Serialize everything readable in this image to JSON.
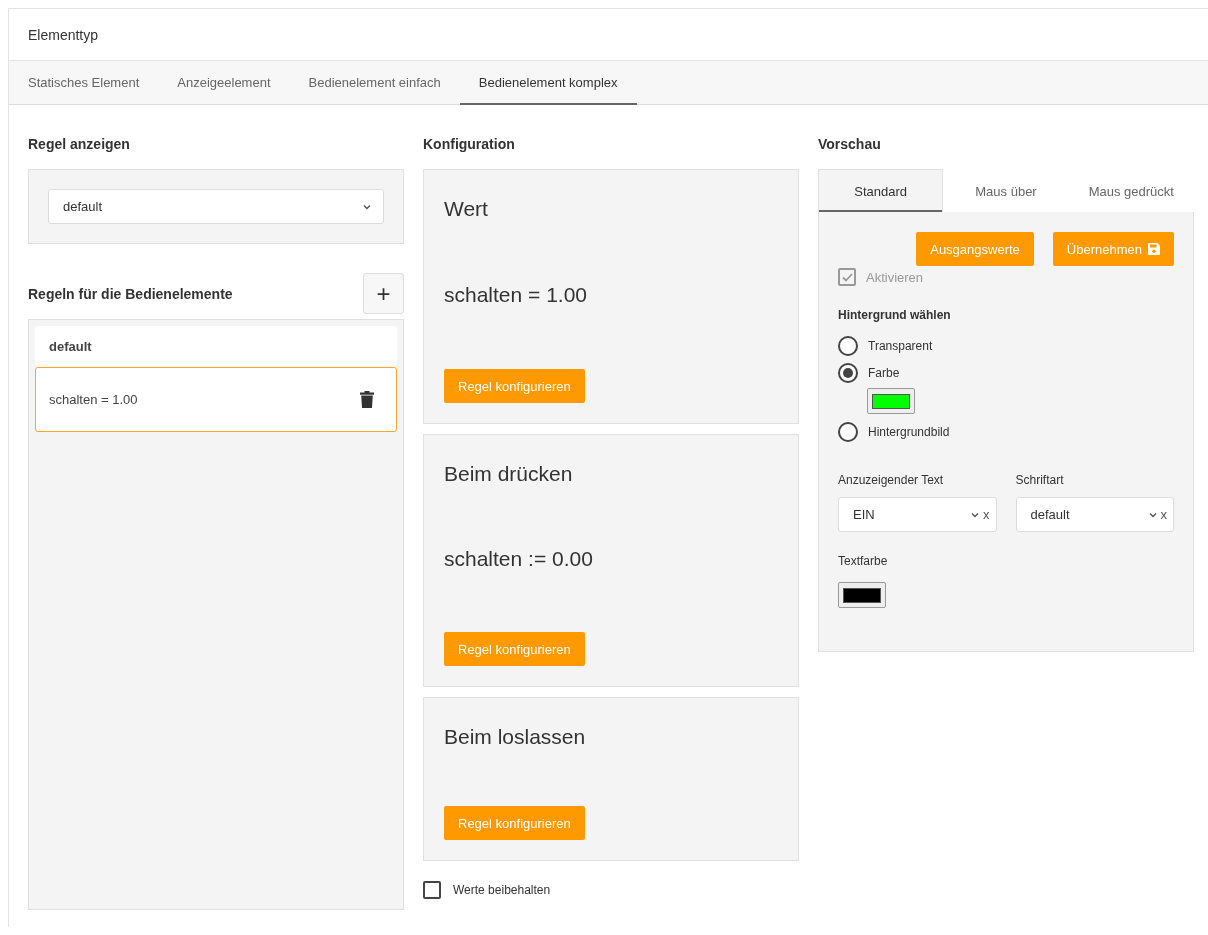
{
  "card": {
    "title": "Elementtyp"
  },
  "tabs": [
    {
      "label": "Statisches Element",
      "selected": false
    },
    {
      "label": "Anzeigeelement",
      "selected": false
    },
    {
      "label": "Bedienelement einfach",
      "selected": false
    },
    {
      "label": "Bedienelement komplex",
      "selected": true
    }
  ],
  "rule_display": {
    "heading": "Regel anzeigen",
    "value": "default"
  },
  "rules": {
    "heading": "Regeln für die Bedienelemente",
    "add_label": "+",
    "items": [
      {
        "label": "default",
        "selected": false,
        "deletable": false
      },
      {
        "label": "schalten = 1.00",
        "selected": true,
        "deletable": true
      }
    ]
  },
  "configuration": {
    "heading": "Konfiguration",
    "sections": [
      {
        "title": "Wert",
        "rule": "schalten = 1.00",
        "button": "Regel konfigurieren"
      },
      {
        "title": "Beim drücken",
        "rule": "schalten := 0.00",
        "button": "Regel konfigurieren"
      },
      {
        "title": "Beim loslassen",
        "button": "Regel konfigurieren"
      }
    ],
    "keep_values": {
      "label": "Werte beibehalten",
      "checked": false
    }
  },
  "preview": {
    "heading": "Vorschau",
    "tabs": [
      {
        "label": "Standard",
        "selected": true
      },
      {
        "label": "Maus über",
        "selected": false
      },
      {
        "label": "Maus gedrückt",
        "selected": false
      }
    ],
    "buttons": [
      "Ausgangswerte",
      "Übernehmen"
    ],
    "activate": {
      "label": "Aktivieren",
      "checked": true,
      "disabled": true
    },
    "background": {
      "label": "Hintergrund wählen",
      "options": [
        {
          "label": "Transparent",
          "selected": false
        },
        {
          "label": "Farbe",
          "selected": true,
          "color": "#00ff00"
        },
        {
          "label": "Hintergrundbild",
          "selected": false
        }
      ]
    },
    "text_field": {
      "label": "Anzuzeigender Text",
      "value": "EIN",
      "clear": "x"
    },
    "font_field": {
      "label": "Schriftart",
      "value": "default",
      "clear": "x"
    },
    "text_color": {
      "label": "Textfarbe",
      "color": "#000000"
    }
  }
}
